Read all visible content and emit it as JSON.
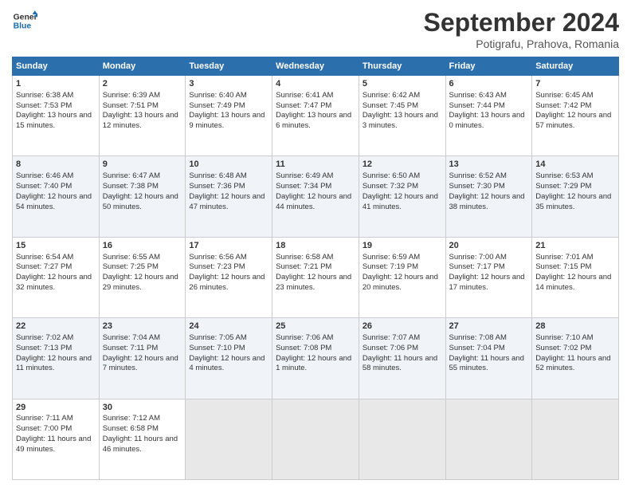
{
  "header": {
    "logo_line1": "General",
    "logo_line2": "Blue",
    "month": "September 2024",
    "location": "Potigrafu, Prahova, Romania"
  },
  "days_of_week": [
    "Sunday",
    "Monday",
    "Tuesday",
    "Wednesday",
    "Thursday",
    "Friday",
    "Saturday"
  ],
  "weeks": [
    [
      {
        "day": "1",
        "sunrise": "Sunrise: 6:38 AM",
        "sunset": "Sunset: 7:53 PM",
        "daylight": "Daylight: 13 hours and 15 minutes."
      },
      {
        "day": "2",
        "sunrise": "Sunrise: 6:39 AM",
        "sunset": "Sunset: 7:51 PM",
        "daylight": "Daylight: 13 hours and 12 minutes."
      },
      {
        "day": "3",
        "sunrise": "Sunrise: 6:40 AM",
        "sunset": "Sunset: 7:49 PM",
        "daylight": "Daylight: 13 hours and 9 minutes."
      },
      {
        "day": "4",
        "sunrise": "Sunrise: 6:41 AM",
        "sunset": "Sunset: 7:47 PM",
        "daylight": "Daylight: 13 hours and 6 minutes."
      },
      {
        "day": "5",
        "sunrise": "Sunrise: 6:42 AM",
        "sunset": "Sunset: 7:45 PM",
        "daylight": "Daylight: 13 hours and 3 minutes."
      },
      {
        "day": "6",
        "sunrise": "Sunrise: 6:43 AM",
        "sunset": "Sunset: 7:44 PM",
        "daylight": "Daylight: 13 hours and 0 minutes."
      },
      {
        "day": "7",
        "sunrise": "Sunrise: 6:45 AM",
        "sunset": "Sunset: 7:42 PM",
        "daylight": "Daylight: 12 hours and 57 minutes."
      }
    ],
    [
      {
        "day": "8",
        "sunrise": "Sunrise: 6:46 AM",
        "sunset": "Sunset: 7:40 PM",
        "daylight": "Daylight: 12 hours and 54 minutes."
      },
      {
        "day": "9",
        "sunrise": "Sunrise: 6:47 AM",
        "sunset": "Sunset: 7:38 PM",
        "daylight": "Daylight: 12 hours and 50 minutes."
      },
      {
        "day": "10",
        "sunrise": "Sunrise: 6:48 AM",
        "sunset": "Sunset: 7:36 PM",
        "daylight": "Daylight: 12 hours and 47 minutes."
      },
      {
        "day": "11",
        "sunrise": "Sunrise: 6:49 AM",
        "sunset": "Sunset: 7:34 PM",
        "daylight": "Daylight: 12 hours and 44 minutes."
      },
      {
        "day": "12",
        "sunrise": "Sunrise: 6:50 AM",
        "sunset": "Sunset: 7:32 PM",
        "daylight": "Daylight: 12 hours and 41 minutes."
      },
      {
        "day": "13",
        "sunrise": "Sunrise: 6:52 AM",
        "sunset": "Sunset: 7:30 PM",
        "daylight": "Daylight: 12 hours and 38 minutes."
      },
      {
        "day": "14",
        "sunrise": "Sunrise: 6:53 AM",
        "sunset": "Sunset: 7:29 PM",
        "daylight": "Daylight: 12 hours and 35 minutes."
      }
    ],
    [
      {
        "day": "15",
        "sunrise": "Sunrise: 6:54 AM",
        "sunset": "Sunset: 7:27 PM",
        "daylight": "Daylight: 12 hours and 32 minutes."
      },
      {
        "day": "16",
        "sunrise": "Sunrise: 6:55 AM",
        "sunset": "Sunset: 7:25 PM",
        "daylight": "Daylight: 12 hours and 29 minutes."
      },
      {
        "day": "17",
        "sunrise": "Sunrise: 6:56 AM",
        "sunset": "Sunset: 7:23 PM",
        "daylight": "Daylight: 12 hours and 26 minutes."
      },
      {
        "day": "18",
        "sunrise": "Sunrise: 6:58 AM",
        "sunset": "Sunset: 7:21 PM",
        "daylight": "Daylight: 12 hours and 23 minutes."
      },
      {
        "day": "19",
        "sunrise": "Sunrise: 6:59 AM",
        "sunset": "Sunset: 7:19 PM",
        "daylight": "Daylight: 12 hours and 20 minutes."
      },
      {
        "day": "20",
        "sunrise": "Sunrise: 7:00 AM",
        "sunset": "Sunset: 7:17 PM",
        "daylight": "Daylight: 12 hours and 17 minutes."
      },
      {
        "day": "21",
        "sunrise": "Sunrise: 7:01 AM",
        "sunset": "Sunset: 7:15 PM",
        "daylight": "Daylight: 12 hours and 14 minutes."
      }
    ],
    [
      {
        "day": "22",
        "sunrise": "Sunrise: 7:02 AM",
        "sunset": "Sunset: 7:13 PM",
        "daylight": "Daylight: 12 hours and 11 minutes."
      },
      {
        "day": "23",
        "sunrise": "Sunrise: 7:04 AM",
        "sunset": "Sunset: 7:11 PM",
        "daylight": "Daylight: 12 hours and 7 minutes."
      },
      {
        "day": "24",
        "sunrise": "Sunrise: 7:05 AM",
        "sunset": "Sunset: 7:10 PM",
        "daylight": "Daylight: 12 hours and 4 minutes."
      },
      {
        "day": "25",
        "sunrise": "Sunrise: 7:06 AM",
        "sunset": "Sunset: 7:08 PM",
        "daylight": "Daylight: 12 hours and 1 minute."
      },
      {
        "day": "26",
        "sunrise": "Sunrise: 7:07 AM",
        "sunset": "Sunset: 7:06 PM",
        "daylight": "Daylight: 11 hours and 58 minutes."
      },
      {
        "day": "27",
        "sunrise": "Sunrise: 7:08 AM",
        "sunset": "Sunset: 7:04 PM",
        "daylight": "Daylight: 11 hours and 55 minutes."
      },
      {
        "day": "28",
        "sunrise": "Sunrise: 7:10 AM",
        "sunset": "Sunset: 7:02 PM",
        "daylight": "Daylight: 11 hours and 52 minutes."
      }
    ],
    [
      {
        "day": "29",
        "sunrise": "Sunrise: 7:11 AM",
        "sunset": "Sunset: 7:00 PM",
        "daylight": "Daylight: 11 hours and 49 minutes."
      },
      {
        "day": "30",
        "sunrise": "Sunrise: 7:12 AM",
        "sunset": "Sunset: 6:58 PM",
        "daylight": "Daylight: 11 hours and 46 minutes."
      },
      null,
      null,
      null,
      null,
      null
    ]
  ]
}
